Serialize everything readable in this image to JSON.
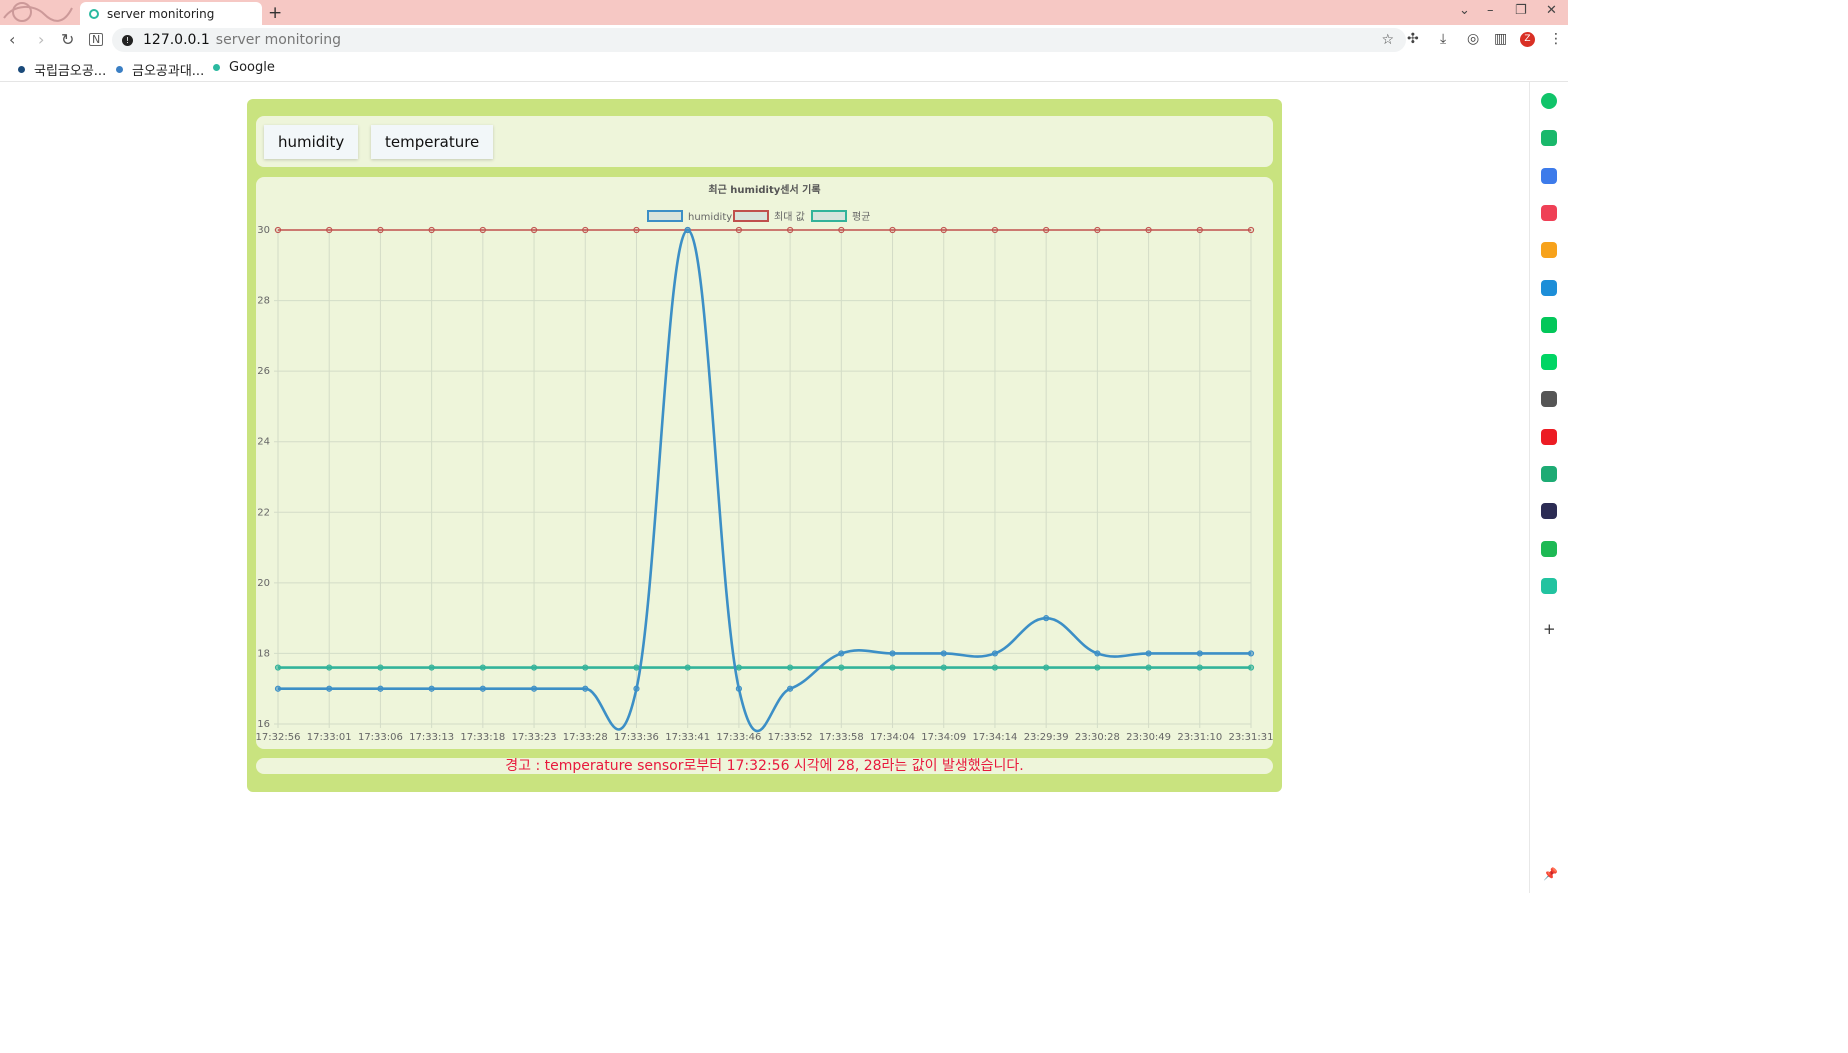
{
  "browser": {
    "tab_title": "server monitoring",
    "new_tab": "+",
    "address_host": "127.0.0.1",
    "address_title": "server monitoring",
    "bookmarks": [
      {
        "label": "국립금오공...",
        "color": "#1a4a7a"
      },
      {
        "label": "금오공과대...",
        "color": "#3b7fc4"
      },
      {
        "label": "Google",
        "color": "#2bb9a0"
      }
    ],
    "window_controls": [
      "⌄",
      "–",
      "❐",
      "✕"
    ],
    "profile_initial": "Z",
    "sidebar_icons": [
      {
        "name": "chatgpt-icon",
        "color": "#10c46a"
      },
      {
        "name": "notification-icon",
        "color": "#19b86b"
      },
      {
        "name": "briefcase-icon",
        "color": "#3d7bea"
      },
      {
        "name": "pocket-icon",
        "color": "#ef4056"
      },
      {
        "name": "star-icon",
        "color": "#f7a21b"
      },
      {
        "name": "edge-icon",
        "color": "#1d8ed8"
      },
      {
        "name": "naver-icon",
        "color": "#03c75a"
      },
      {
        "name": "webtoon-icon",
        "color": "#00d564"
      },
      {
        "name": "gallery-icon",
        "color": "#555555"
      },
      {
        "name": "wow-icon",
        "color": "#ec1c24"
      },
      {
        "name": "owl-icon",
        "color": "#1dab74"
      },
      {
        "name": "dino-icon",
        "color": "#2c2c54"
      },
      {
        "name": "spotify-icon",
        "color": "#1db954"
      },
      {
        "name": "play-icon",
        "color": "#22c3a0"
      }
    ]
  },
  "page": {
    "buttons": {
      "humidity": "humidity",
      "temperature": "temperature"
    },
    "warning": "경고 : temperature sensor로부터 17:32:56 시각에 28, 28라는 값이 발생했습니다."
  },
  "chart_data": {
    "type": "line",
    "title": "최근 humidity센서 기록",
    "x": [
      "17:32:56",
      "17:33:01",
      "17:33:06",
      "17:33:13",
      "17:33:18",
      "17:33:23",
      "17:33:28",
      "17:33:36",
      "17:33:41",
      "17:33:46",
      "17:33:52",
      "17:33:58",
      "17:34:04",
      "17:34:09",
      "17:34:14",
      "23:29:39",
      "23:30:28",
      "23:30:49",
      "23:31:10",
      "23:31:31"
    ],
    "ylim": [
      16,
      30
    ],
    "yticks": [
      16,
      18,
      20,
      22,
      24,
      26,
      28,
      30
    ],
    "grid": true,
    "legend_position": "top",
    "series": [
      {
        "name": "humidity",
        "color": "#3c8fc6",
        "values": [
          17,
          17,
          17,
          17,
          17,
          17,
          17,
          17,
          30,
          17,
          17,
          18,
          18,
          18,
          18,
          19,
          18,
          18,
          18,
          18
        ]
      },
      {
        "name": "최대 값",
        "color": "#c0504d",
        "values": [
          30,
          30,
          30,
          30,
          30,
          30,
          30,
          30,
          30,
          30,
          30,
          30,
          30,
          30,
          30,
          30,
          30,
          30,
          30,
          30
        ]
      },
      {
        "name": "평균",
        "color": "#33b39a",
        "values": [
          17.6,
          17.6,
          17.6,
          17.6,
          17.6,
          17.6,
          17.6,
          17.6,
          17.6,
          17.6,
          17.6,
          17.6,
          17.6,
          17.6,
          17.6,
          17.6,
          17.6,
          17.6,
          17.6,
          17.6
        ]
      }
    ]
  }
}
